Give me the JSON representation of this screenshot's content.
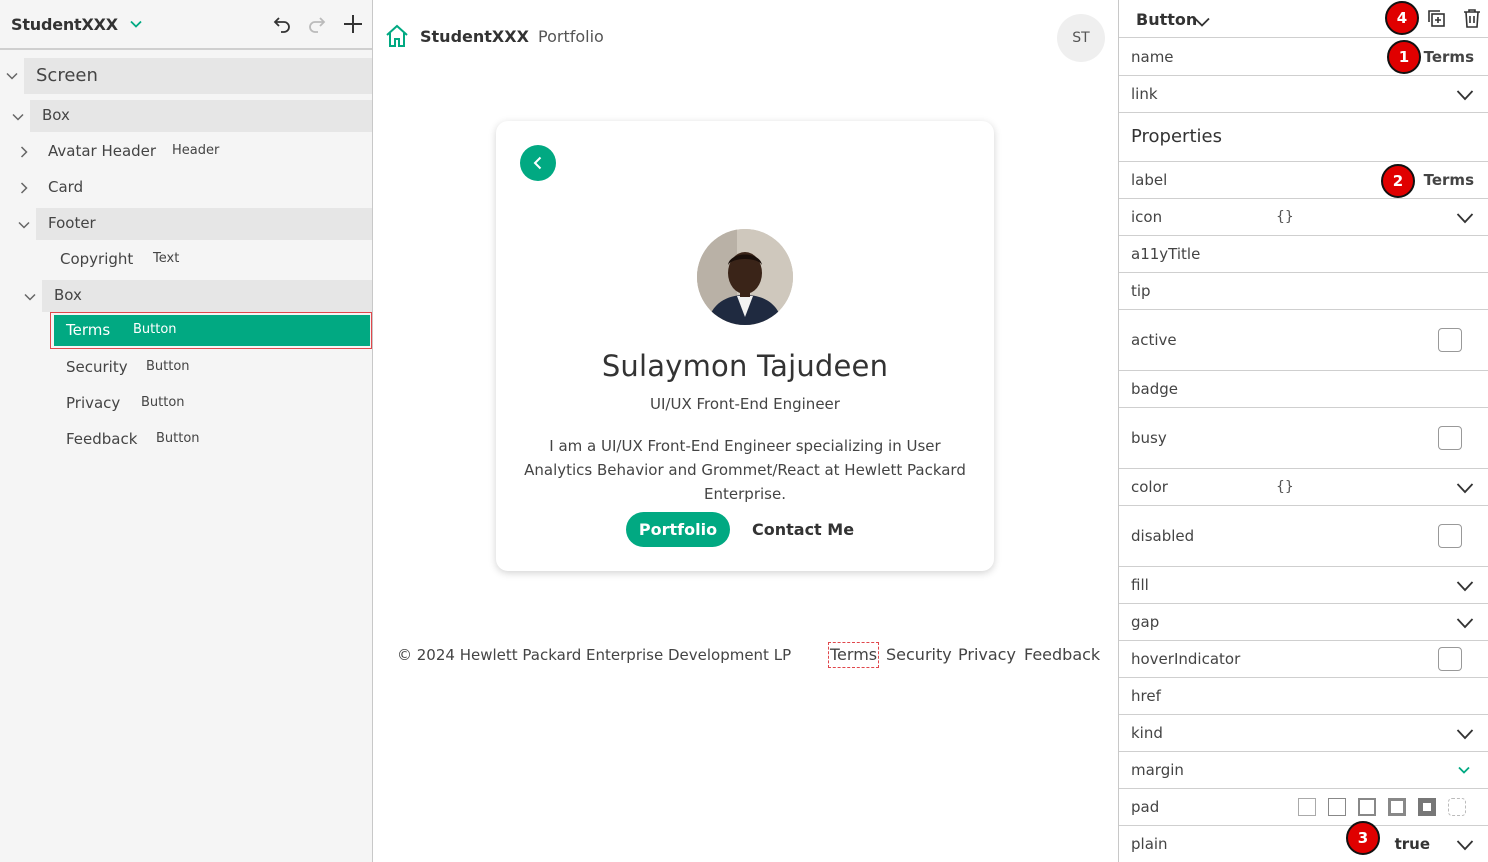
{
  "left_panel": {
    "app_title": "StudentXXX",
    "tree": {
      "screen": "Screen",
      "box1": "Box",
      "avatar_header": {
        "label": "Avatar Header",
        "type": "Header"
      },
      "card": "Card",
      "footer": "Footer",
      "copyright": {
        "label": "Copyright",
        "type": "Text"
      },
      "box2": "Box",
      "terms": {
        "label": "Terms",
        "type": "Button"
      },
      "security": {
        "label": "Security",
        "type": "Button"
      },
      "privacy": {
        "label": "Privacy",
        "type": "Button"
      },
      "feedback": {
        "label": "Feedback",
        "type": "Button"
      }
    }
  },
  "preview": {
    "brand_name": "StudentXXX",
    "brand_sub": "Portfolio",
    "user_initials": "ST",
    "profile": {
      "name": "Sulaymon Tajudeen",
      "role": "UI/UX Front-End Engineer",
      "bio": "I am a UI/UX Front-End Engineer specializing in User Analytics Behavior and Grommet/React at Hewlett Packard Enterprise.",
      "primary_button": "Portfolio",
      "secondary_button": "Contact Me"
    },
    "footer": {
      "copyright": "© 2024 Hewlett Packard Enterprise Development LP",
      "links": [
        "Terms",
        "Security",
        "Privacy",
        "Feedback"
      ]
    }
  },
  "right_panel": {
    "component_type": "Button",
    "name": {
      "label": "name",
      "value": "Terms"
    },
    "link_label": "link",
    "properties_title": "Properties",
    "label_prop": {
      "label": "label",
      "value": "Terms"
    },
    "braces": "{}",
    "props": {
      "icon": "icon",
      "a11yTitle": "a11yTitle",
      "tip": "tip",
      "active": "active",
      "badge": "badge",
      "busy": "busy",
      "color": "color",
      "disabled": "disabled",
      "fill": "fill",
      "gap": "gap",
      "hoverIndicator": "hoverIndicator",
      "href": "href",
      "kind": "kind",
      "margin": "margin",
      "pad": "pad",
      "plain": "plain"
    },
    "plain_value": "true"
  },
  "annotations": [
    "1",
    "2",
    "3",
    "4"
  ],
  "colors": {
    "accent": "#01a982",
    "selection_outline": "#e0474c",
    "annotation_badge": "#e00000"
  }
}
